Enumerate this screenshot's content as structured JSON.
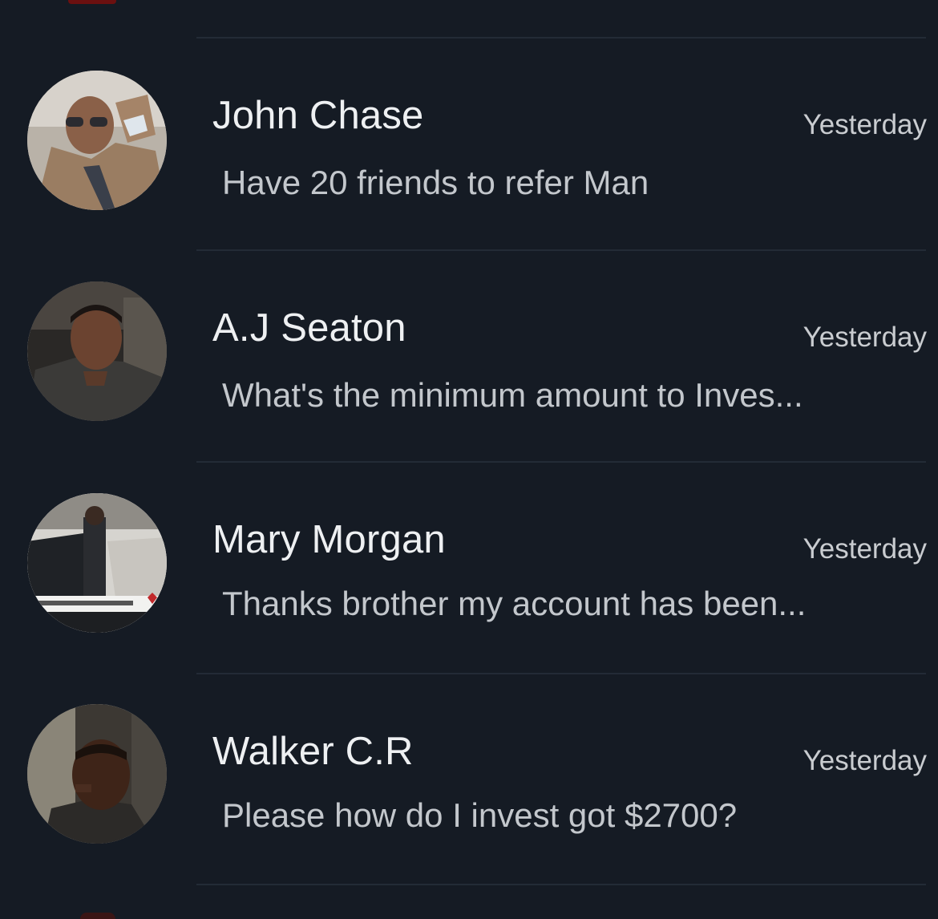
{
  "conversations": [
    {
      "name": "John Chase",
      "time": "Yesterday",
      "preview": "Have 20 friends to refer Man",
      "avatar": "avatar-john-chase"
    },
    {
      "name": "A.J  Seaton",
      "time": "Yesterday",
      "preview": "What's the minimum amount to Inves...",
      "avatar": "avatar-aj-seaton"
    },
    {
      "name": "Mary Morgan",
      "time": "Yesterday",
      "preview": "Thanks brother my account has been...",
      "avatar": "avatar-mary-morgan"
    },
    {
      "name": "Walker C.R",
      "time": "Yesterday",
      "preview": "Please how do I invest got $2700?",
      "avatar": "avatar-walker-cr"
    }
  ],
  "colors": {
    "background": "#151b24",
    "divider": "#232b36",
    "name_text": "#eef0f2",
    "preview_text": "#c3c7cc",
    "time_text": "#c9ccd0"
  }
}
